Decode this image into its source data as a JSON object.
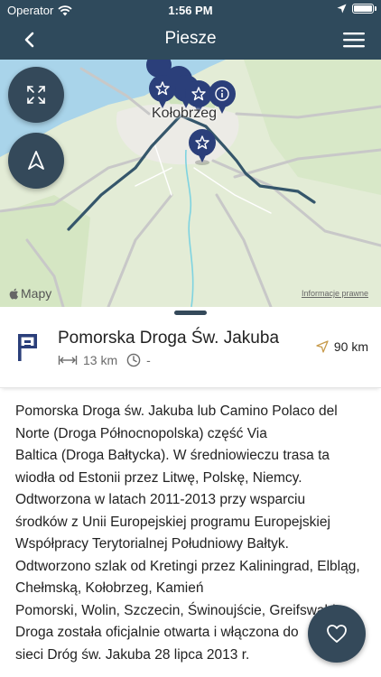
{
  "status_bar": {
    "operator": "Operator",
    "time": "1:56 PM"
  },
  "navbar": {
    "title": "Piesze"
  },
  "map": {
    "city_label": "Kołobrzeg",
    "attribution_brand": "Mapy",
    "legal_link": "Informacje prawne"
  },
  "route": {
    "name": "Pomorska Droga Św. Jakuba",
    "length": "13 km",
    "duration": "-",
    "distance": "90 km"
  },
  "description_lines": [
    "Pomorska Droga św. Jakuba lub Camino Polaco del",
    "Norte (Droga Północnopolska) część Via",
    "Baltica (Droga Bałtycka). W średniowieczu trasa ta",
    "wiodła od Estonii przez Litwę, Polskę, Niemcy.",
    "Odtworzona w latach 2011-2013 przy wsparciu",
    "środków z Unii Europejskiej programu Europejskiej",
    "Współpracy Terytorialnej Południowy Bałtyk.",
    "Odtworzono szlak od Kretingi przez Kaliningrad, Elbląg,",
    "Chełmską, Kołobrzeg, Kamień",
    "Pomorski, Wolin, Szczecin, Świnoujście, Greifswald.",
    "Droga została oficjalnie otwarta i włączona do",
    "sieci Dróg św. Jakuba 28 lipca 2013 r."
  ],
  "colors": {
    "primary": "#2f4a5c",
    "fab": "#34495a",
    "pin": "#2b3f7a",
    "route_line": "#35566b",
    "water": "#a9d4ea",
    "land": "#e3ecd6"
  },
  "icons": [
    "wifi-icon",
    "location-arrow-icon",
    "battery-icon",
    "chevron-left-icon",
    "hamburger-menu-icon",
    "expand-icon",
    "navigate-arrow-icon",
    "star-pin-icon",
    "info-pin-icon",
    "apple-logo-icon",
    "trail-flag-icon",
    "length-icon",
    "clock-icon",
    "direction-arrow-icon",
    "heart-icon"
  ]
}
